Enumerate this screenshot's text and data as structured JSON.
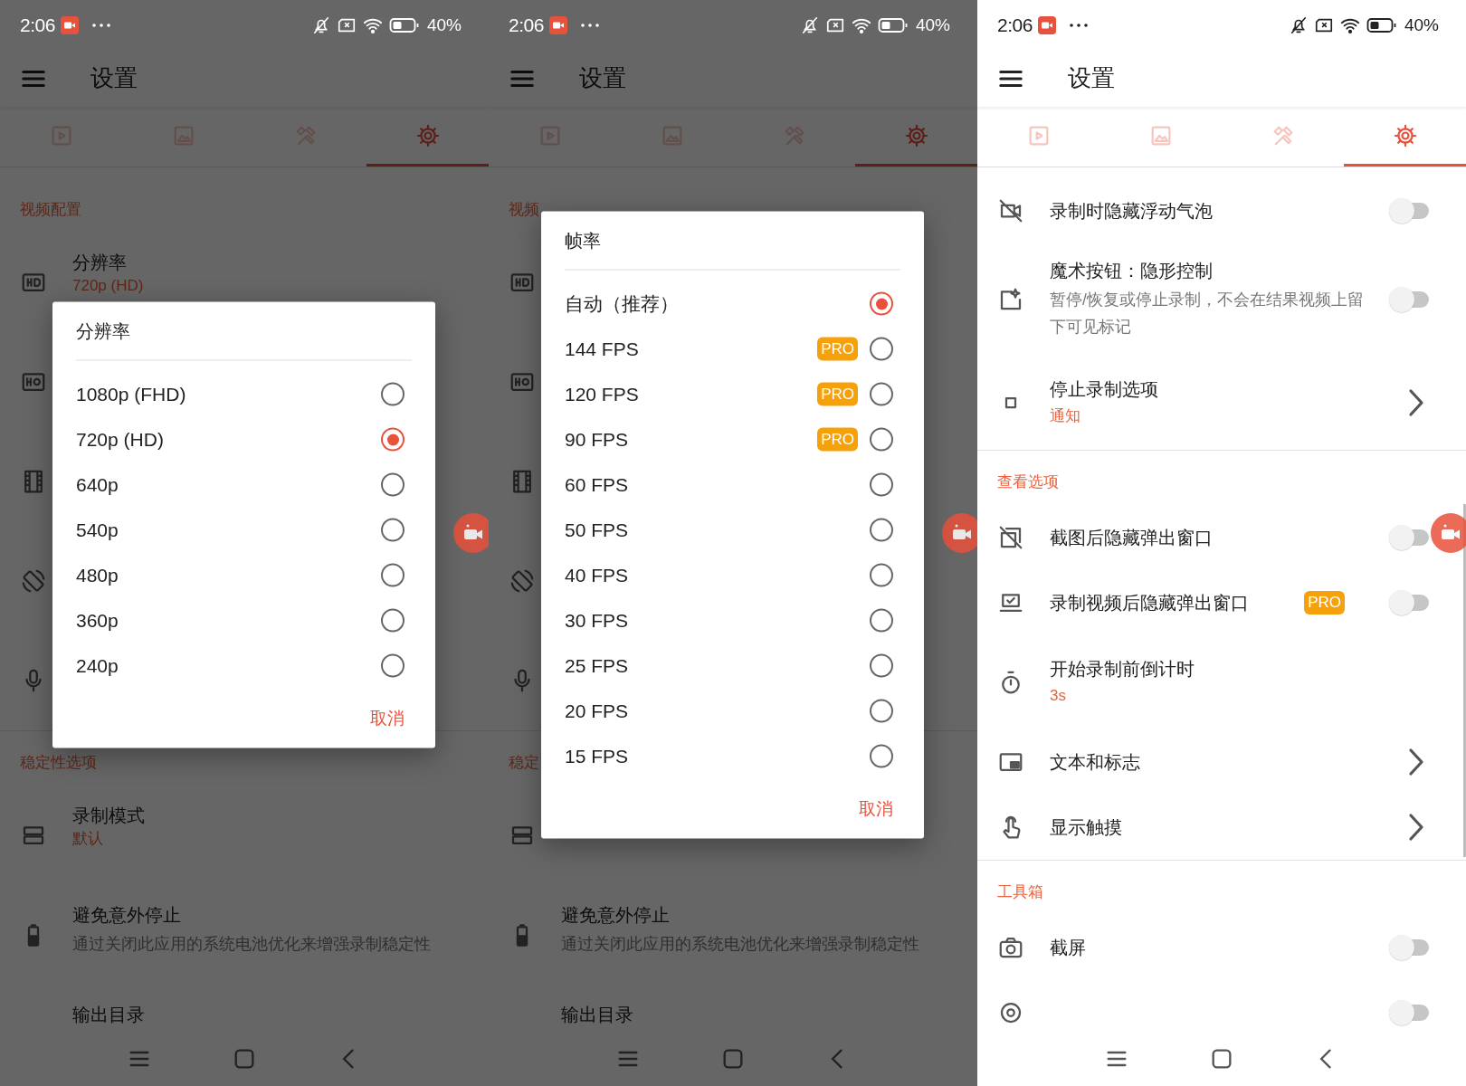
{
  "screens": [
    {
      "status_bar": {
        "time": "2:06",
        "battery": "40%"
      },
      "app_bar": {
        "title": "设置"
      },
      "tabs": [
        {
          "selected": false
        },
        {
          "selected": false
        },
        {
          "selected": false
        },
        {
          "selected": true
        }
      ],
      "items": [
        {
          "kind": "header",
          "title": "视频配置"
        },
        {
          "kind": "setting",
          "title": "分辨率",
          "subtitle": "720p (HD)"
        },
        {
          "kind": "setting"
        },
        {
          "kind": "setting"
        },
        {
          "kind": "setting"
        },
        {
          "kind": "setting"
        },
        {
          "kind": "divider"
        },
        {
          "kind": "header",
          "title": "稳定性选项"
        },
        {
          "kind": "setting",
          "title": "录制模式",
          "subtitle": "默认"
        },
        {
          "kind": "setting",
          "title": "避免意外停止",
          "description": "通过关闭此应用的系统电池优化来增强录制稳定性"
        },
        {
          "kind": "setting",
          "title": "输出目录"
        }
      ],
      "dialog": {
        "title": "分辨率",
        "options": [
          {
            "label": "1080p (FHD)",
            "selected": false
          },
          {
            "label": "720p (HD)",
            "selected": true
          },
          {
            "label": "640p",
            "selected": false
          },
          {
            "label": "540p",
            "selected": false
          },
          {
            "label": "480p",
            "selected": false
          },
          {
            "label": "360p",
            "selected": false
          },
          {
            "label": "240p",
            "selected": false
          }
        ],
        "cancel": "取消"
      }
    },
    {
      "status_bar": {
        "time": "2:06",
        "battery": "40%"
      },
      "app_bar": {
        "title": "设置"
      },
      "tabs": [
        {
          "selected": false
        },
        {
          "selected": false
        },
        {
          "selected": false
        },
        {
          "selected": true
        }
      ],
      "items": [
        {
          "kind": "header",
          "title": "视频"
        },
        {
          "kind": "setting"
        },
        {
          "kind": "setting"
        },
        {
          "kind": "setting"
        },
        {
          "kind": "setting"
        },
        {
          "kind": "setting"
        },
        {
          "kind": "divider"
        },
        {
          "kind": "header",
          "title": "稳定"
        },
        {
          "kind": "setting"
        },
        {
          "kind": "setting",
          "title": "避免意外停止",
          "description": "通过关闭此应用的系统电池优化来增强录制稳定性"
        },
        {
          "kind": "setting",
          "title": "输出目录"
        }
      ],
      "dialog": {
        "title": "帧率",
        "options": [
          {
            "label": "自动（推荐）",
            "selected": true
          },
          {
            "label": "144 FPS",
            "badge": "PRO",
            "selected": false
          },
          {
            "label": "120 FPS",
            "badge": "PRO",
            "selected": false
          },
          {
            "label": "90 FPS",
            "badge": "PRO",
            "selected": false
          },
          {
            "label": "60 FPS",
            "selected": false
          },
          {
            "label": "50 FPS",
            "selected": false
          },
          {
            "label": "40 FPS",
            "selected": false
          },
          {
            "label": "30 FPS",
            "selected": false
          },
          {
            "label": "25 FPS",
            "selected": false
          },
          {
            "label": "20 FPS",
            "selected": false
          },
          {
            "label": "15 FPS",
            "selected": false
          }
        ],
        "cancel": "取消"
      }
    },
    {
      "status_bar": {
        "time": "2:06",
        "battery": "40%"
      },
      "app_bar": {
        "title": "设置"
      },
      "tabs": [
        {
          "selected": false
        },
        {
          "selected": false
        },
        {
          "selected": false
        },
        {
          "selected": true
        }
      ],
      "items": [
        {
          "kind": "toggle",
          "title": "录制时隐藏浮动气泡",
          "on": false
        },
        {
          "kind": "toggle",
          "title": "魔术按钮：隐形控制",
          "description": "暂停/恢复或停止录制，不会在结果视频上留下可见标记",
          "on": false
        },
        {
          "kind": "link",
          "title": "停止录制选项",
          "subtitle": "通知"
        },
        {
          "kind": "divider"
        },
        {
          "kind": "header",
          "title": "查看选项"
        },
        {
          "kind": "toggle",
          "title": "截图后隐藏弹出窗口",
          "on": false
        },
        {
          "kind": "toggle",
          "title": "录制视频后隐藏弹出窗口",
          "badge": "PRO",
          "on": false
        },
        {
          "kind": "value",
          "title": "开始录制前倒计时",
          "subtitle": "3s"
        },
        {
          "kind": "link",
          "title": "文本和标志"
        },
        {
          "kind": "link",
          "title": "显示触摸"
        },
        {
          "kind": "divider"
        },
        {
          "kind": "header",
          "title": "工具箱"
        },
        {
          "kind": "toggle",
          "title": "截屏",
          "on": false
        },
        {
          "kind": "toggle",
          "on": false
        }
      ]
    }
  ]
}
